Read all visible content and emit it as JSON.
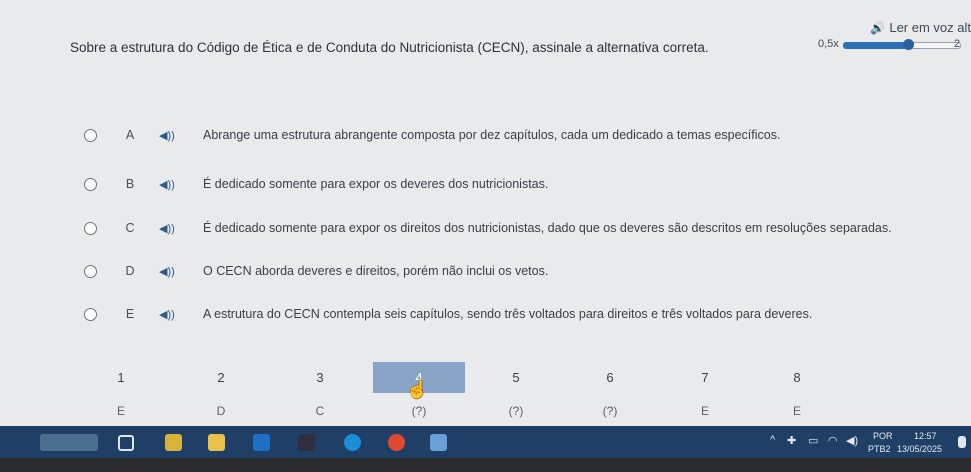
{
  "tts": {
    "label": "Ler em voz alt",
    "speed_min": "0,5x",
    "speed_max": "2",
    "speed_fraction": 0.55
  },
  "question": "Sobre a estrutura do Código de Ética e de Conduta do Nutricionista (CECN), assinale a alternativa correta.",
  "options": [
    {
      "letter": "A",
      "text": "Abrange uma estrutura abrangente composta por dez capítulos, cada um dedicado a temas específicos."
    },
    {
      "letter": "B",
      "text": "É dedicado somente para expor os deveres dos nutricionistas."
    },
    {
      "letter": "C",
      "text": "É dedicado somente para expor os direitos dos nutricionistas, dado que os deveres são descritos em resoluções separadas."
    },
    {
      "letter": "D",
      "text": "O CECN aborda deveres e direitos, porém não inclui os vetos."
    },
    {
      "letter": "E",
      "text": "A estrutura do CECN contempla seis capítulos, sendo três voltados para direitos e três voltados para deveres."
    }
  ],
  "navigation": {
    "current": "4",
    "items": [
      {
        "number": "1",
        "answer": "E"
      },
      {
        "number": "2",
        "answer": "D"
      },
      {
        "number": "3",
        "answer": "C"
      },
      {
        "number": "4",
        "answer": "(?)"
      },
      {
        "number": "5",
        "answer": "(?)"
      },
      {
        "number": "6",
        "answer": "(?)"
      },
      {
        "number": "7",
        "answer": "E"
      },
      {
        "number": "8",
        "answer": "E"
      }
    ]
  },
  "taskbar": {
    "language": "POR",
    "layout": "PTB2",
    "time": "12:57",
    "date": "13/05/2025",
    "colors": {
      "bar": "#1f3f66",
      "accent": "#2f6fb5"
    }
  }
}
